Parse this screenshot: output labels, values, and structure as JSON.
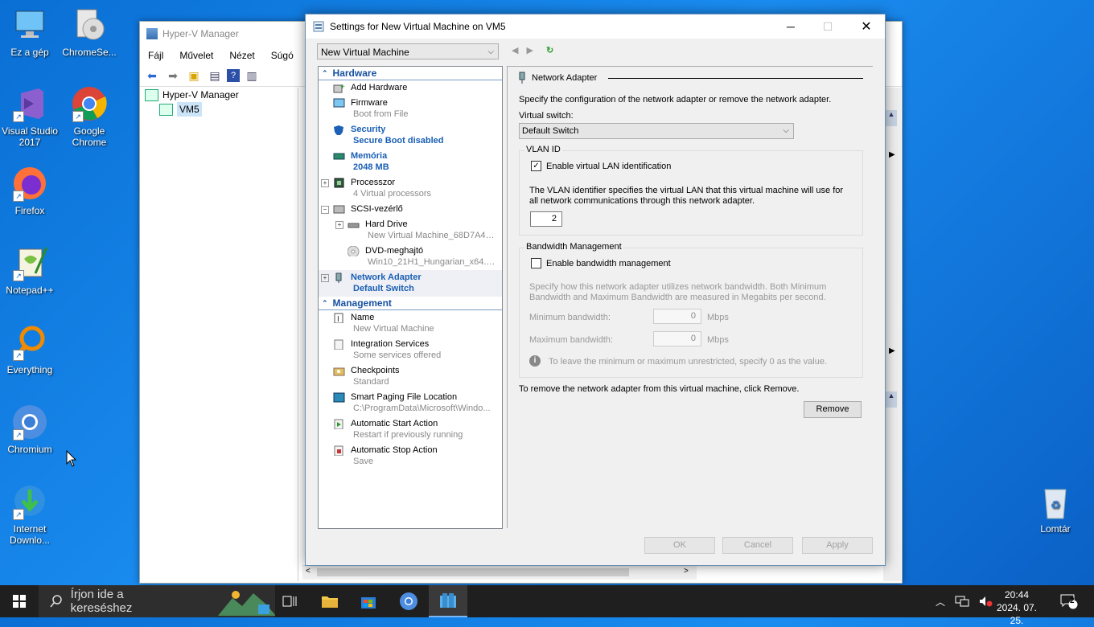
{
  "desktop": {
    "icons": [
      {
        "label": "Ez a gép"
      },
      {
        "label": "ChromeSe..."
      },
      {
        "label": "Visual Studio 2017"
      },
      {
        "label": "Google Chrome"
      },
      {
        "label": "Firefox"
      },
      {
        "label": "Notepad++"
      },
      {
        "label": "Everything"
      },
      {
        "label": "Chromium"
      },
      {
        "label": "Internet Downlo..."
      },
      {
        "label": "Lomtár"
      }
    ]
  },
  "hyperv": {
    "title": "Hyper-V Manager",
    "menu": [
      "Fájl",
      "Művelet",
      "Nézet",
      "Súgó"
    ],
    "tree": {
      "root": "Hyper-V Manager",
      "child": "VM5"
    }
  },
  "dialog": {
    "title": "Settings for New Virtual Machine on VM5",
    "vm_selector": "New Virtual Machine",
    "sections": {
      "hardware": "Hardware",
      "management": "Management"
    },
    "hardware_items": [
      {
        "name": "Add Hardware",
        "sub": ""
      },
      {
        "name": "Firmware",
        "sub": "Boot from File"
      },
      {
        "name": "Security",
        "sub": "Secure Boot disabled"
      },
      {
        "name": "Memória",
        "sub": "2048 MB"
      },
      {
        "name": "Processzor",
        "sub": "4 Virtual processors"
      },
      {
        "name": "SCSI-vezérlő",
        "sub": ""
      },
      {
        "name": "Hard Drive",
        "sub": "New Virtual Machine_68D7A47..."
      },
      {
        "name": "DVD-meghajtó",
        "sub": "Win10_21H1_Hungarian_x64.iso"
      },
      {
        "name": "Network Adapter",
        "sub": "Default Switch"
      }
    ],
    "management_items": [
      {
        "name": "Name",
        "sub": "New Virtual Machine"
      },
      {
        "name": "Integration Services",
        "sub": "Some services offered"
      },
      {
        "name": "Checkpoints",
        "sub": "Standard"
      },
      {
        "name": "Smart Paging File Location",
        "sub": "C:\\ProgramData\\Microsoft\\Windo..."
      },
      {
        "name": "Automatic Start Action",
        "sub": "Restart if previously running"
      },
      {
        "name": "Automatic Stop Action",
        "sub": "Save"
      }
    ],
    "panel": {
      "heading": "Network Adapter",
      "description": "Specify the configuration of the network adapter or remove the network adapter.",
      "switch_label": "Virtual switch:",
      "switch_value": "Default Switch",
      "vlan_group": "VLAN ID",
      "vlan_checkbox": "Enable virtual LAN identification",
      "vlan_checked": true,
      "vlan_description": "The VLAN identifier specifies the virtual LAN that this virtual machine will use for all network communications through this network adapter.",
      "vlan_value": "2",
      "bw_group": "Bandwidth Management",
      "bw_checkbox": "Enable bandwidth management",
      "bw_checked": false,
      "bw_description": "Specify how this network adapter utilizes network bandwidth. Both Minimum Bandwidth and Maximum Bandwidth are measured in Megabits per second.",
      "min_label": "Minimum bandwidth:",
      "min_value": "0",
      "max_label": "Maximum bandwidth:",
      "max_value": "0",
      "unit": "Mbps",
      "bw_note": "To leave the minimum or maximum unrestricted, specify 0 as the value.",
      "remove_text": "To remove the network adapter from this virtual machine, click Remove.",
      "remove_button": "Remove"
    },
    "buttons": {
      "ok": "OK",
      "cancel": "Cancel",
      "apply": "Apply"
    }
  },
  "taskbar": {
    "search_placeholder": "Írjon ide a kereséshez",
    "time": "20:44",
    "date": "2024. 07. 25.",
    "notifications": "2"
  }
}
